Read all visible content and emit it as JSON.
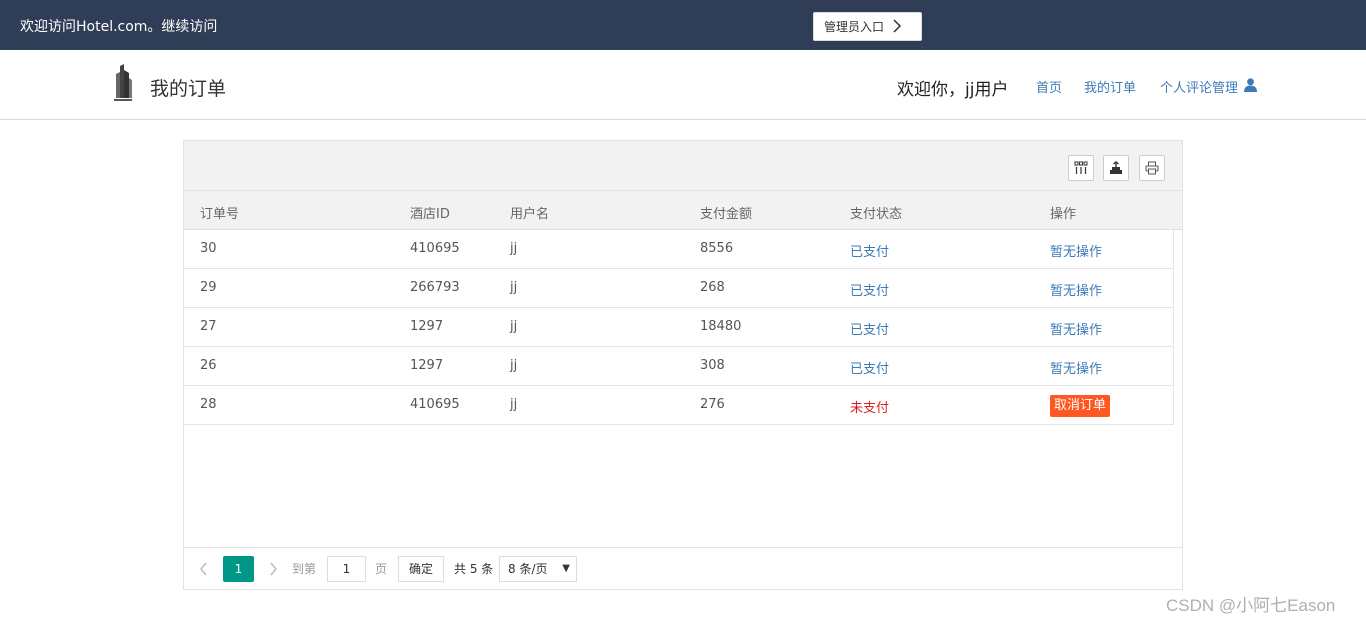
{
  "topbar": {
    "welcome": "欢迎访问Hotel.com。继续访问",
    "admin_label": "管理员入口"
  },
  "header": {
    "title": "我的订单",
    "greeting": "欢迎你，jj用户",
    "nav": {
      "home": "首页",
      "orders": "我的订单",
      "reviews": "个人评论管理"
    }
  },
  "table": {
    "columns": [
      "订单号",
      "酒店ID",
      "用户名",
      "支付金额",
      "支付状态",
      "操作"
    ],
    "rows": [
      {
        "order_id": "30",
        "hotel_id": "410695",
        "user": "jj",
        "amount": "8556",
        "status": "已支付",
        "action": "暂无操作"
      },
      {
        "order_id": "29",
        "hotel_id": "266793",
        "user": "jj",
        "amount": "268",
        "status": "已支付",
        "action": "暂无操作"
      },
      {
        "order_id": "27",
        "hotel_id": "1297",
        "user": "jj",
        "amount": "18480",
        "status": "已支付",
        "action": "暂无操作"
      },
      {
        "order_id": "26",
        "hotel_id": "1297",
        "user": "jj",
        "amount": "308",
        "status": "已支付",
        "action": "暂无操作"
      },
      {
        "order_id": "28",
        "hotel_id": "410695",
        "user": "jj",
        "amount": "276",
        "status": "未支付",
        "action": "取消订单"
      }
    ]
  },
  "pagination": {
    "current_page": "1",
    "goto_label": "到第",
    "page_input": "1",
    "page_suffix": "页",
    "confirm": "确定",
    "total": "共 5 条",
    "page_size": "8 条/页"
  },
  "watermark": "CSDN @小阿七Eason",
  "colors": {
    "topbar_bg": "#2f3e56",
    "link": "#3d7ab8",
    "unpaid": "#e02020",
    "cancel_button": "#ff5722",
    "current_page": "#009688"
  }
}
